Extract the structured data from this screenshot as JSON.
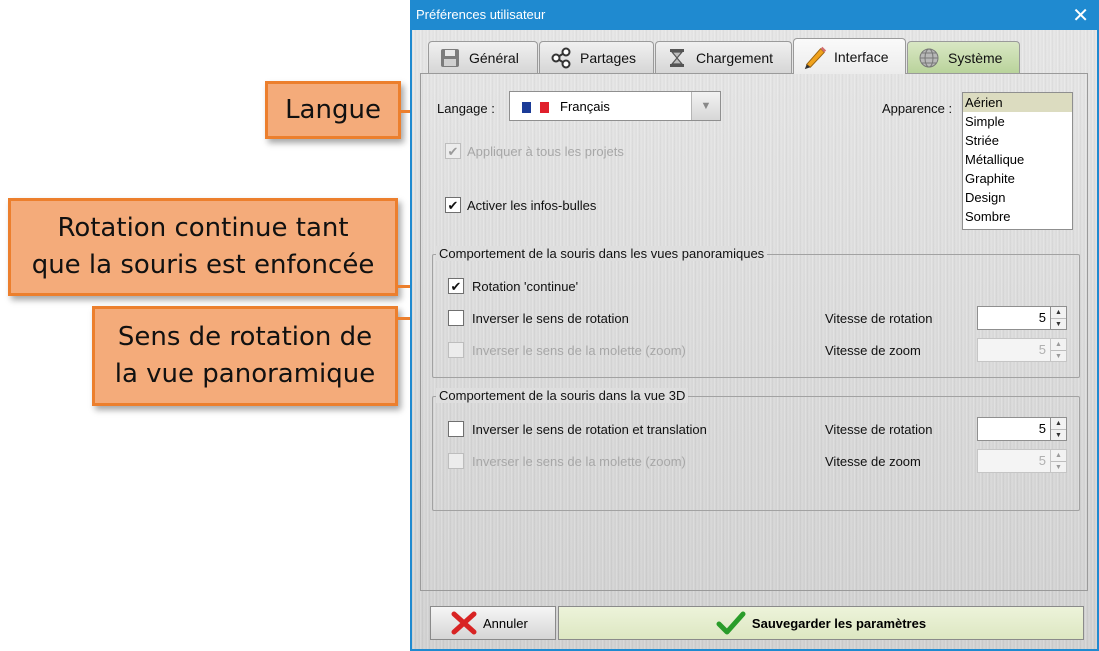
{
  "callouts": {
    "langue": "Langue",
    "rotation_line1": "Rotation continue tant",
    "rotation_line2": "que la souris est enfoncée",
    "sens_line1": "Sens de rotation de",
    "sens_line2": "la vue panoramique"
  },
  "window": {
    "title": "Préférences utilisateur",
    "close_glyph": "✕"
  },
  "tabs": [
    {
      "label": "Général",
      "icon": "floppy-disk-icon"
    },
    {
      "label": "Partages",
      "icon": "share-icon"
    },
    {
      "label": "Chargement",
      "icon": "hourglass-icon"
    },
    {
      "label": "Interface",
      "icon": "pencil-icon",
      "active": true
    },
    {
      "label": "Système",
      "icon": "globe-icon"
    }
  ],
  "interface": {
    "language_label": "Langage :",
    "language_value": "Français",
    "language_flag_colors": [
      "#1b3b97",
      "#ffffff",
      "#e0202c"
    ],
    "appearance_label": "Apparence :",
    "appearance_options": [
      "Aérien",
      "Simple",
      "Striée",
      "Métallique",
      "Graphite",
      "Design",
      "Sombre"
    ],
    "appearance_selected": "Aérien",
    "apply_all": {
      "label": "Appliquer à tous les projets",
      "checked": true,
      "enabled": false
    },
    "tooltips": {
      "label": "Activer les infos-bulles",
      "checked": true,
      "enabled": true
    },
    "pano_group": {
      "title": "Comportement de la souris dans les vues panoramiques",
      "continuous_rotation": {
        "label": "Rotation 'continue'",
        "checked": true,
        "enabled": true
      },
      "invert_rotation": {
        "label": "Inverser le sens de rotation",
        "checked": false,
        "enabled": true
      },
      "invert_wheel": {
        "label": "Inverser le sens de la molette (zoom)",
        "checked": false,
        "enabled": false
      },
      "rotation_speed_label": "Vitesse de rotation",
      "rotation_speed": "5",
      "zoom_speed_label": "Vitesse de zoom",
      "zoom_speed": "5"
    },
    "view3d_group": {
      "title": "Comportement de la souris dans la vue 3D",
      "invert_rotation": {
        "label": "Inverser le sens de rotation et translation",
        "checked": false,
        "enabled": true
      },
      "invert_wheel": {
        "label": "Inverser le sens de la molette (zoom)",
        "checked": false,
        "enabled": false
      },
      "rotation_speed_label": "Vitesse de rotation",
      "rotation_speed": "5",
      "zoom_speed_label": "Vitesse de zoom",
      "zoom_speed": "5"
    }
  },
  "footer": {
    "cancel_label": "Annuler",
    "save_label": "Sauvegarder les paramètres"
  },
  "glyphs": {
    "check": "✔",
    "up": "▲",
    "down": "▼"
  }
}
